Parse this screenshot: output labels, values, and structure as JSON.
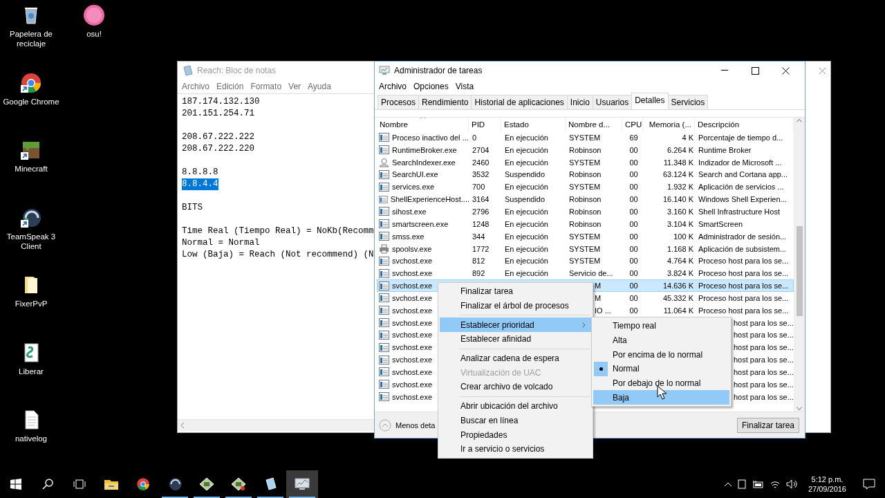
{
  "desktop_icons": [
    {
      "label": "Papelera de reciclaje",
      "kind": "recycle_bin",
      "shortcut": false
    },
    {
      "label": "Google Chrome",
      "kind": "chrome",
      "shortcut": true
    },
    {
      "label": "Minecraft",
      "kind": "minecraft",
      "shortcut": true
    },
    {
      "label": "TeamSpeak 3 Client",
      "kind": "teamspeak",
      "shortcut": true
    },
    {
      "label": "FixerPvP",
      "kind": "folder",
      "shortcut": false
    },
    {
      "label": "Liberar",
      "kind": "script",
      "shortcut": false
    },
    {
      "label": "nativelog",
      "kind": "text_file",
      "shortcut": false
    },
    {
      "label": "osu!",
      "kind": "osu",
      "shortcut": false
    }
  ],
  "notepad": {
    "title": "Reach: Bloc de notas",
    "menu": [
      "Archivo",
      "Edición",
      "Formato",
      "Ver",
      "Ayuda"
    ],
    "paragraphs": [
      [
        {
          "text": "187.174.132.130",
          "selected": false
        },
        {
          "text": "201.151.254.71",
          "selected": false
        }
      ],
      [
        {
          "text": "208.67.222.222",
          "selected": false
        },
        {
          "text": "208.67.222.220",
          "selected": false
        }
      ],
      [
        {
          "text": "8.8.8.8",
          "selected": false
        },
        {
          "text": "8.8.4.4",
          "selected": true
        }
      ],
      [
        {
          "text": "BITS",
          "selected": false
        }
      ],
      [
        {
          "text": "Time Real (Tiempo Real) = NoKb(Recomm",
          "selected": false
        },
        {
          "text": "Normal = Normal",
          "selected": false
        },
        {
          "text": "Low (Baja) = Reach (Not recommend) (N",
          "selected": false
        }
      ]
    ]
  },
  "task_manager": {
    "title": "Administrador de tareas",
    "menu": [
      "Archivo",
      "Opciones",
      "Vista"
    ],
    "tabs": [
      {
        "label": "Procesos",
        "selected": false
      },
      {
        "label": "Rendimiento",
        "selected": false
      },
      {
        "label": "Historial de aplicaciones",
        "selected": false
      },
      {
        "label": "Inicio",
        "selected": false
      },
      {
        "label": "Usuarios",
        "selected": false
      },
      {
        "label": "Detalles",
        "selected": true
      },
      {
        "label": "Servicios",
        "selected": false
      }
    ],
    "columns": [
      {
        "label": "Nombre",
        "sorted": true
      },
      {
        "label": "PID",
        "sorted": false
      },
      {
        "label": "Estado",
        "sorted": false
      },
      {
        "label": "Nombre d...",
        "sorted": false
      },
      {
        "label": "CPU",
        "sorted": false
      },
      {
        "label": "Memoria (...",
        "sorted": false
      },
      {
        "label": "Descripción",
        "sorted": false
      }
    ],
    "rows": [
      {
        "kind": "app",
        "selected": false,
        "cells": {
          "name": "Proceso inactivo del ...",
          "pid": "0",
          "status": "En ejecución",
          "user": "SYSTEM",
          "cpu": "69",
          "memory": "4 K",
          "description": "Porcentaje de tiempo d..."
        }
      },
      {
        "kind": "app",
        "selected": false,
        "cells": {
          "name": "RuntimeBroker.exe",
          "pid": "2704",
          "status": "En ejecución",
          "user": "Robinson",
          "cpu": "00",
          "memory": "6.264 K",
          "description": "Runtime Broker"
        }
      },
      {
        "kind": "person",
        "selected": false,
        "cells": {
          "name": "SearchIndexer.exe",
          "pid": "2460",
          "status": "En ejecución",
          "user": "SYSTEM",
          "cpu": "00",
          "memory": "11.348 K",
          "description": "Indizador de Microsoft ..."
        }
      },
      {
        "kind": "app",
        "selected": false,
        "cells": {
          "name": "SearchUI.exe",
          "pid": "3532",
          "status": "Suspendido",
          "user": "Robinson",
          "cpu": "00",
          "memory": "63.124 K",
          "description": "Search and Cortana app..."
        }
      },
      {
        "kind": "app",
        "selected": false,
        "cells": {
          "name": "services.exe",
          "pid": "700",
          "status": "En ejecución",
          "user": "SYSTEM",
          "cpu": "00",
          "memory": "1.932 K",
          "description": "Aplicación de servicios ..."
        }
      },
      {
        "kind": "app",
        "selected": false,
        "cells": {
          "name": "ShellExperienceHost....",
          "pid": "3164",
          "status": "Suspendido",
          "user": "Robinson",
          "cpu": "00",
          "memory": "16.140 K",
          "description": "Windows Shell Experien..."
        }
      },
      {
        "kind": "app",
        "selected": false,
        "cells": {
          "name": "sihost.exe",
          "pid": "2796",
          "status": "En ejecución",
          "user": "Robinson",
          "cpu": "00",
          "memory": "3.160 K",
          "description": "Shell Infrastructure Host"
        }
      },
      {
        "kind": "app",
        "selected": false,
        "cells": {
          "name": "smartscreen.exe",
          "pid": "1248",
          "status": "En ejecución",
          "user": "Robinson",
          "cpu": "00",
          "memory": "3.104 K",
          "description": "SmartScreen"
        }
      },
      {
        "kind": "app",
        "selected": false,
        "cells": {
          "name": "smss.exe",
          "pid": "344",
          "status": "En ejecución",
          "user": "SYSTEM",
          "cpu": "00",
          "memory": "100 K",
          "description": "Administrador de sesión..."
        }
      },
      {
        "kind": "printer",
        "selected": false,
        "cells": {
          "name": "spoolsv.exe",
          "pid": "1772",
          "status": "En ejecución",
          "user": "SYSTEM",
          "cpu": "00",
          "memory": "1.168 K",
          "description": "Aplicación de subsistem..."
        }
      },
      {
        "kind": "app",
        "selected": false,
        "cells": {
          "name": "svchost.exe",
          "pid": "812",
          "status": "En ejecución",
          "user": "SYSTEM",
          "cpu": "00",
          "memory": "4.764 K",
          "description": "Proceso host para los se..."
        }
      },
      {
        "kind": "app",
        "selected": false,
        "cells": {
          "name": "svchost.exe",
          "pid": "892",
          "status": "En ejecución",
          "user": "Servicio de...",
          "cpu": "00",
          "memory": "3.824 K",
          "description": "Proceso host para los se..."
        }
      },
      {
        "kind": "app",
        "selected": true,
        "cells": {
          "name": "svchost.exe",
          "user": "M",
          "cpu": "00",
          "memory": "14.636 K",
          "description": "Proceso host para los se..."
        }
      },
      {
        "kind": "app",
        "selected": false,
        "cells": {
          "name": "svchost.exe",
          "user": "M",
          "cpu": "00",
          "memory": "45.332 K",
          "description": "Proceso host para los se..."
        }
      },
      {
        "kind": "app",
        "selected": false,
        "cells": {
          "name": "svchost.exe",
          "user": "IO ...",
          "cpu": "00",
          "memory": "11.064 K",
          "description": "Proceso host para los se..."
        }
      },
      {
        "kind": "app",
        "selected": false,
        "cells": {
          "name": "svchost.exe",
          "description": "host para los se..."
        }
      },
      {
        "kind": "app",
        "selected": false,
        "cells": {
          "name": "svchost.exe",
          "description": "host para los se..."
        }
      },
      {
        "kind": "app",
        "selected": false,
        "cells": {
          "name": "svchost.exe",
          "description": "host para los se..."
        }
      },
      {
        "kind": "app",
        "selected": false,
        "cells": {
          "name": "svchost.exe",
          "description": "host para los se..."
        }
      },
      {
        "kind": "app",
        "selected": false,
        "cells": {
          "name": "svchost.exe",
          "description": "host para los se..."
        }
      },
      {
        "kind": "app",
        "selected": false,
        "cells": {
          "name": "svchost.exe",
          "description": "host para los se..."
        }
      },
      {
        "kind": "app",
        "selected": false,
        "cells": {
          "name": "svchost.exe",
          "description": "host para los se..."
        }
      }
    ],
    "fewer_details": "Menos deta",
    "end_task_button": "Finalizar tarea"
  },
  "context_menu": {
    "groups": [
      [
        {
          "label": "Finalizar tarea",
          "disabled": false,
          "selected": false,
          "submenu": false
        },
        {
          "label": "Finalizar el árbol de procesos",
          "disabled": false,
          "selected": false,
          "submenu": false
        }
      ],
      [
        {
          "label": "Establecer prioridad",
          "disabled": false,
          "selected": true,
          "submenu": true
        },
        {
          "label": "Establecer afinidad",
          "disabled": false,
          "selected": false,
          "submenu": false
        }
      ],
      [
        {
          "label": "Analizar cadena de espera",
          "disabled": false,
          "selected": false,
          "submenu": false
        },
        {
          "label": "Virtualización de UAC",
          "disabled": true,
          "selected": false,
          "submenu": false
        },
        {
          "label": "Crear archivo de volcado",
          "disabled": false,
          "selected": false,
          "submenu": false
        }
      ],
      [
        {
          "label": "Abrir ubicación del archivo",
          "disabled": false,
          "selected": false,
          "submenu": false
        },
        {
          "label": "Buscar en línea",
          "disabled": false,
          "selected": false,
          "submenu": false
        },
        {
          "label": "Propiedades",
          "disabled": false,
          "selected": false,
          "submenu": false
        },
        {
          "label": "Ir a servicio o servicios",
          "disabled": false,
          "selected": false,
          "submenu": false
        }
      ]
    ]
  },
  "priority_submenu": {
    "items": [
      {
        "label": "Tiempo real",
        "checked": false,
        "selected": false
      },
      {
        "label": "Alta",
        "checked": false,
        "selected": false
      },
      {
        "label": "Por encima de lo normal",
        "checked": false,
        "selected": false
      },
      {
        "label": "Normal",
        "checked": true,
        "selected": false
      },
      {
        "label": "Por debajo de lo normal",
        "checked": false,
        "selected": false
      },
      {
        "label": "Baja",
        "checked": false,
        "selected": true
      }
    ]
  },
  "taskbar": {
    "apps": [
      {
        "kind": "explorer",
        "running": false,
        "selected": false
      },
      {
        "kind": "chrome",
        "running": false,
        "selected": false
      },
      {
        "kind": "teamspeak",
        "running": true,
        "selected": false
      },
      {
        "kind": "photo_app",
        "running": true,
        "selected": false
      },
      {
        "kind": "photo_app_alt",
        "running": true,
        "selected": false
      },
      {
        "kind": "notepad",
        "running": true,
        "selected": false
      },
      {
        "kind": "task_manager",
        "running": true,
        "selected": true
      }
    ],
    "clock": {
      "time": "5:12 p.m.",
      "date": "27/09/2016"
    }
  }
}
